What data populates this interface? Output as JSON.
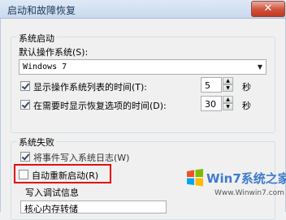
{
  "window": {
    "title": "启动和故障恢复",
    "close_glyph": "✕"
  },
  "system_startup": {
    "group_label": "系统启动",
    "default_os_label": "默认操作系统(S):",
    "default_os_value": "Windows 7",
    "show_os_list": {
      "label": "显示操作系统列表的时间(T):",
      "checked": true,
      "value": "5",
      "unit": "秒"
    },
    "show_recovery": {
      "label": "在需要时显示恢复选项的时间(D):",
      "checked": true,
      "value": "30",
      "unit": "秒"
    }
  },
  "system_failure": {
    "group_label": "系统失败",
    "write_event_log": {
      "label": "将事件写入系统日志(W)",
      "checked": true
    },
    "auto_restart": {
      "label": "自动重新启动(R)",
      "checked": false
    },
    "debug_info_label": "写入调试信息",
    "debug_info_value": "核心内存转储"
  },
  "watermark": {
    "brand": "Win7系统之家",
    "url": "Www.Winwin7.com"
  },
  "colors": {
    "highlight": "#e01010",
    "title_text": "#1e395b"
  }
}
